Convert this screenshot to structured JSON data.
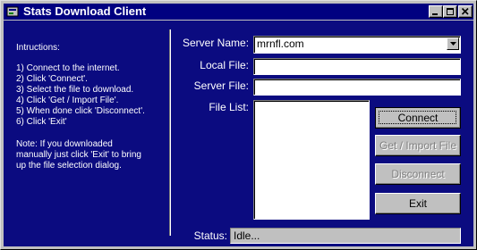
{
  "window": {
    "title": "Stats Download Client",
    "title_bar_color": "#000080",
    "client_color": "#0b0b80",
    "icons": [
      "app-icon",
      "minimize-icon",
      "maximize-icon",
      "close-icon"
    ]
  },
  "instructions": {
    "heading": "Intructions:",
    "steps": [
      "1) Connect to the internet.",
      "2) Click 'Connect'.",
      "3) Select the file to download.",
      "4) Click 'Get / Import File'.",
      "5) When done click 'Disconnect'.",
      "6) Click 'Exit'"
    ],
    "note": [
      "Note: If you downloaded",
      "manually just click 'Exit' to bring",
      "up the file selection dialog."
    ]
  },
  "form": {
    "server_name_label": "Server Name:",
    "server_name_value": "mrnfl.com",
    "local_file_label": "Local File:",
    "local_file_value": "",
    "server_file_label": "Server File:",
    "server_file_value": "",
    "file_list_label": "File List:"
  },
  "buttons": {
    "connect": "Connect",
    "get_import": "Get / Import File",
    "disconnect": "Disconnect",
    "exit": "Exit"
  },
  "status": {
    "label": "Status:",
    "value": "Idle..."
  }
}
